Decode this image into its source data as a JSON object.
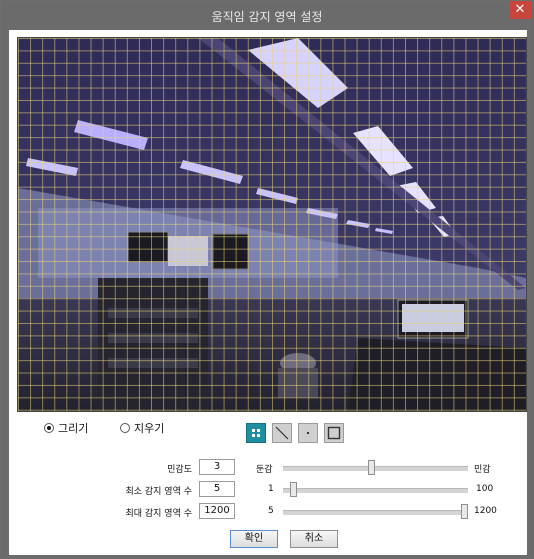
{
  "window": {
    "title": "움직임 감지 영역 설정"
  },
  "icons": {
    "close": "close-icon",
    "tools": [
      "grid-select-icon",
      "line-draw-icon",
      "point-draw-icon",
      "rectangle-draw-icon"
    ]
  },
  "mode": {
    "draw_label": "그리기",
    "erase_label": "지우기",
    "selected": "draw"
  },
  "params": {
    "sensitivity": {
      "label": "민감도",
      "value": "3",
      "min_label": "둔감",
      "max_label": "민감",
      "level_fraction": 0.48
    },
    "min_area": {
      "label": "최소 감지 영역 수",
      "value": "5",
      "min_label": "1",
      "max_label": "100",
      "level_fraction": 0.04
    },
    "max_area": {
      "label": "최대 감지 영역 수",
      "value": "1200",
      "min_label": "5",
      "max_label": "1200",
      "level_fraction": 1.0
    }
  },
  "buttons": {
    "ok": "확인",
    "cancel": "취소"
  },
  "colors": {
    "titlebar": "#6b6b6b",
    "close": "#c9463d",
    "active_tool": "#1f8ea0",
    "grid": "#ebd278"
  }
}
